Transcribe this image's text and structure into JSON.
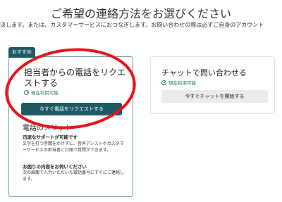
{
  "header": {
    "title": "ご希望の連絡方法をお選びください",
    "intro": "決します。または、カスタマーサービスにおつなぎします。お問い合わせの際は必ずご自身のアカウント"
  },
  "recommended_card": {
    "badge": "おすすめ",
    "title": "担当者からの電話をリクエストする",
    "status": "現在利用可能",
    "button": "今すぐ電話をリクエストする",
    "merits_title": "電話のメリット",
    "merits": [
      {
        "heading": "迅速なサポートが可能です",
        "text": "文字を打つ手間をかけずに、音声アシストやカスタマーサービスの担当者に口頭で質問ができます。"
      },
      {
        "heading": "お困りの内容をお伺いください",
        "text": "次の画面で入力いただいた電話番号にすぐにご連絡します。"
      }
    ]
  },
  "chat_card": {
    "title": "チャットで問い合わせる",
    "status": "現在利用可能",
    "button": "今すぐチャットを開始する"
  },
  "colors": {
    "accent": "#1f5a63",
    "available": "#2f7d4f",
    "annotation": "#e8141b"
  },
  "icons": {
    "status": "clock-icon"
  }
}
